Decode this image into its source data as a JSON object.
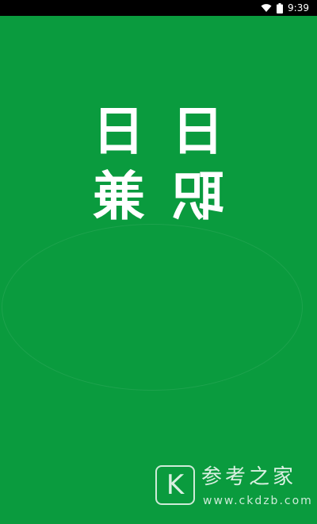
{
  "status_bar": {
    "time": "9:39",
    "icons": [
      "wifi-icon",
      "battery-icon"
    ]
  },
  "splash": {
    "background": "#0a9b3e",
    "logo": {
      "glyphs": [
        "日",
        "日",
        "兼",
        "职"
      ],
      "mirrored": true,
      "color": "#ffffff"
    }
  },
  "watermark": {
    "badge_letter": "K",
    "title": "参考之家",
    "url": "www.ckdzb.com"
  }
}
